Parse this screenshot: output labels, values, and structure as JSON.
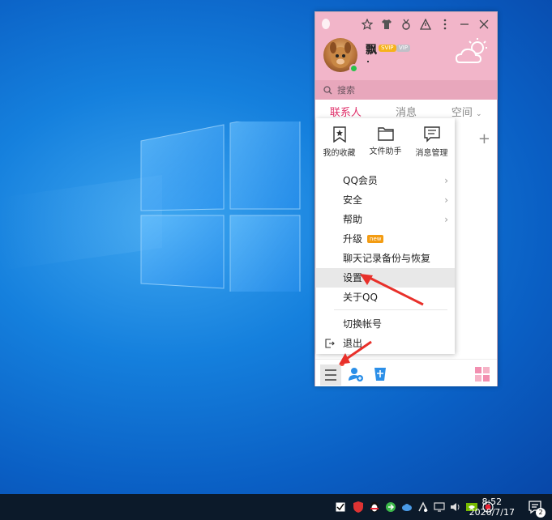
{
  "desktop": {
    "background": "#0a62c8"
  },
  "qq": {
    "user": {
      "nickname": "飘",
      "vip_badge_1": "SVIP",
      "vip_badge_2": "VIP",
      "status_color": "#28c24a"
    },
    "search": {
      "placeholder": "搜索"
    },
    "tabs": [
      {
        "label": "联系人",
        "active": true
      },
      {
        "label": "消息",
        "active": false
      },
      {
        "label": "空间",
        "active": false
      }
    ],
    "colors": {
      "header": "#f2b5c9",
      "search_bar": "#e8a7bc",
      "accent": "#e0306a"
    }
  },
  "menu": {
    "quick": [
      {
        "label": "我的收藏",
        "icon": "star-bookmark-icon"
      },
      {
        "label": "文件助手",
        "icon": "folder-icon"
      },
      {
        "label": "消息管理",
        "icon": "message-box-icon"
      }
    ],
    "items": [
      {
        "label": "QQ会员",
        "arrow": true
      },
      {
        "label": "安全",
        "arrow": true
      },
      {
        "label": "帮助",
        "arrow": true
      },
      {
        "label": "升级",
        "badge": "new"
      },
      {
        "label": "聊天记录备份与恢复"
      },
      {
        "label": "设置",
        "highlighted": true
      },
      {
        "label": "关于QQ"
      },
      {
        "label": "切换帐号"
      },
      {
        "label": "退出"
      }
    ]
  },
  "taskbar": {
    "time": "8:52",
    "date": "2020/7/17",
    "notification_count": "2"
  },
  "annotations": {
    "arrow_color": "#e8302a"
  }
}
